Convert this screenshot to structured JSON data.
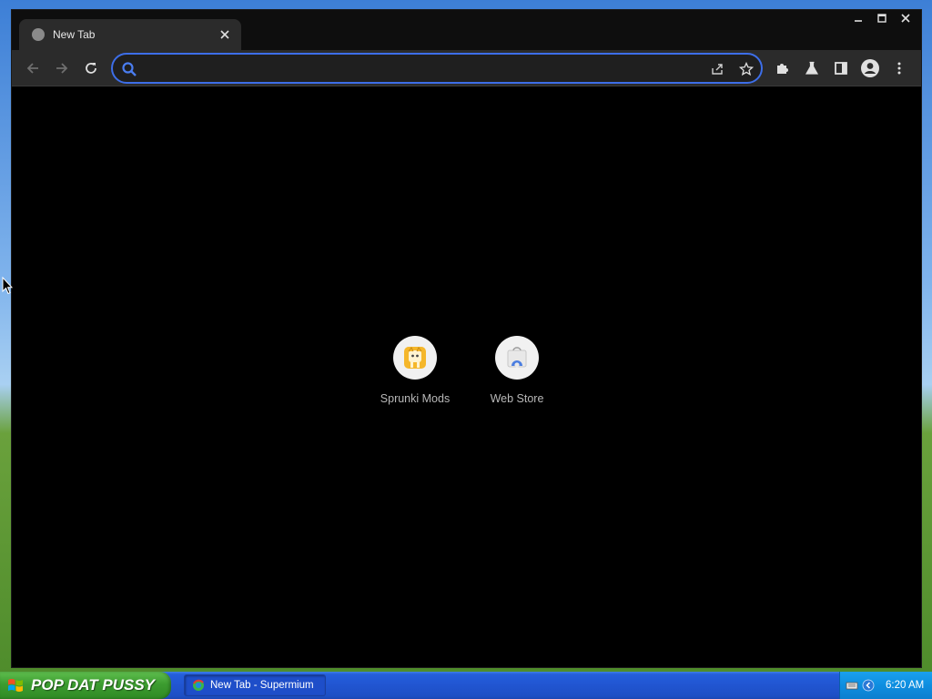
{
  "browser": {
    "tab": {
      "title": "New Tab"
    },
    "omnibox": {
      "value": "",
      "placeholder": ""
    },
    "accent_color": "#3d6ee8"
  },
  "shortcuts": [
    {
      "label": "Sprunki Mods",
      "icon": "sprunki-mods-icon",
      "icon_color": "#f5b72b"
    },
    {
      "label": "Web Store",
      "icon": "web-store-icon",
      "icon_color": "#4a7de0"
    }
  ],
  "taskbar": {
    "start_label": "POP DAT PUSSY",
    "task_item": "New Tab - Supermium",
    "clock": "6:20 AM",
    "start_color": "#3c9c30",
    "bar_color": "#245edb"
  }
}
